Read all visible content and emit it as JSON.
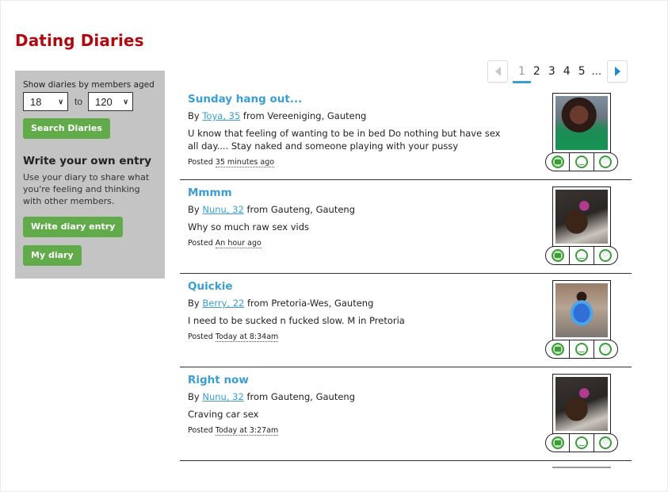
{
  "page": {
    "title": "Dating Diaries"
  },
  "sidebar": {
    "age_filter_label": "Show diaries by members aged",
    "age_min": "18",
    "age_to_label": "to",
    "age_max": "120",
    "search_button": "Search Diaries",
    "write_title": "Write your own entry",
    "write_description": "Use your diary to share what you're feeling and thinking with other members.",
    "write_button": "Write diary entry",
    "my_diary_button": "My diary"
  },
  "pagination": {
    "pages": [
      "1",
      "2",
      "3",
      "4",
      "5"
    ],
    "current": "1",
    "ellipsis": "..."
  },
  "entries": [
    {
      "title": "Sunday hang out...",
      "by_label": "By",
      "author": "Toya, 35",
      "location": "from Vereeniging, Gauteng",
      "body": "U know that feeling of wanting to be in bed Do nothing but have sex all day.... Stay naked and someone playing with your pussy",
      "posted_label": "Posted",
      "posted_time": "35 minutes ago"
    },
    {
      "title": "Mmmm",
      "by_label": "By",
      "author": "Nunu, 32",
      "location": "from Gauteng, Gauteng",
      "body": "Why so much raw sex vids",
      "posted_label": "Posted",
      "posted_time": "An hour ago"
    },
    {
      "title": "Quickie",
      "by_label": "By",
      "author": "Berry, 22",
      "location": "from Pretoria-Wes, Gauteng",
      "body": "I need to be sucked n fucked slow. M in Pretoria",
      "posted_label": "Posted",
      "posted_time": "Today at 8:34am"
    },
    {
      "title": "Right now",
      "by_label": "By",
      "author": "Nunu, 32",
      "location": "from Gauteng, Gauteng",
      "body": "Craving car sex",
      "posted_label": "Posted",
      "posted_time": "Today at 3:27am"
    }
  ],
  "actions": {
    "icons": [
      "message-icon",
      "wink-icon",
      "like-icon"
    ]
  },
  "colors": {
    "title_red": "#b0090f",
    "link_blue": "#3a9ed4",
    "button_green": "#62ab4a",
    "sidebar_gray": "#c4c4c4",
    "icon_green": "#3c9c3c"
  }
}
